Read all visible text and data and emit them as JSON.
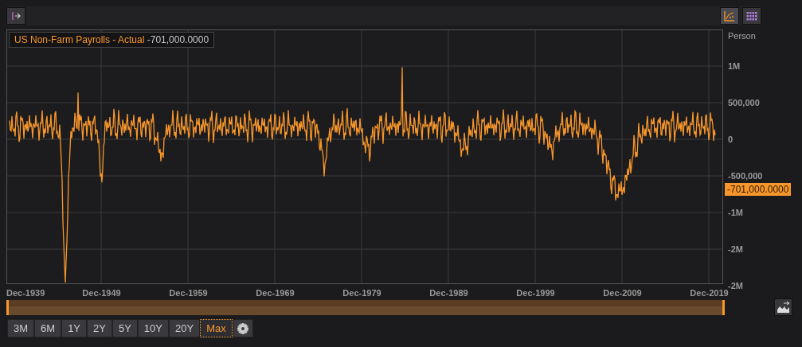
{
  "toolbar": {
    "view_toggles": [
      {
        "kind": "chart",
        "selected": true
      },
      {
        "kind": "table",
        "selected": false
      }
    ]
  },
  "legend": {
    "series_name": "US Non-Farm Payrolls - Actual",
    "value": "-701,000.0000"
  },
  "y_axis": {
    "unit": "Person",
    "labels": [
      "1M",
      "500,000",
      "0",
      "-500,000",
      "-1M",
      "-2M",
      "-2M"
    ],
    "last_value_tag": "-701,000.0000"
  },
  "x_axis": {
    "labels": [
      "Dec-1939",
      "Dec-1949",
      "Dec-1959",
      "Dec-1969",
      "Dec-1979",
      "Dec-1989",
      "Dec-1999",
      "Dec-2009",
      "Dec-2019"
    ]
  },
  "ranges": [
    {
      "label": "3M",
      "selected": false
    },
    {
      "label": "6M",
      "selected": false
    },
    {
      "label": "1Y",
      "selected": false
    },
    {
      "label": "2Y",
      "selected": false
    },
    {
      "label": "5Y",
      "selected": false
    },
    {
      "label": "10Y",
      "selected": false
    },
    {
      "label": "20Y",
      "selected": false
    },
    {
      "label": "Max",
      "selected": true
    }
  ]
}
